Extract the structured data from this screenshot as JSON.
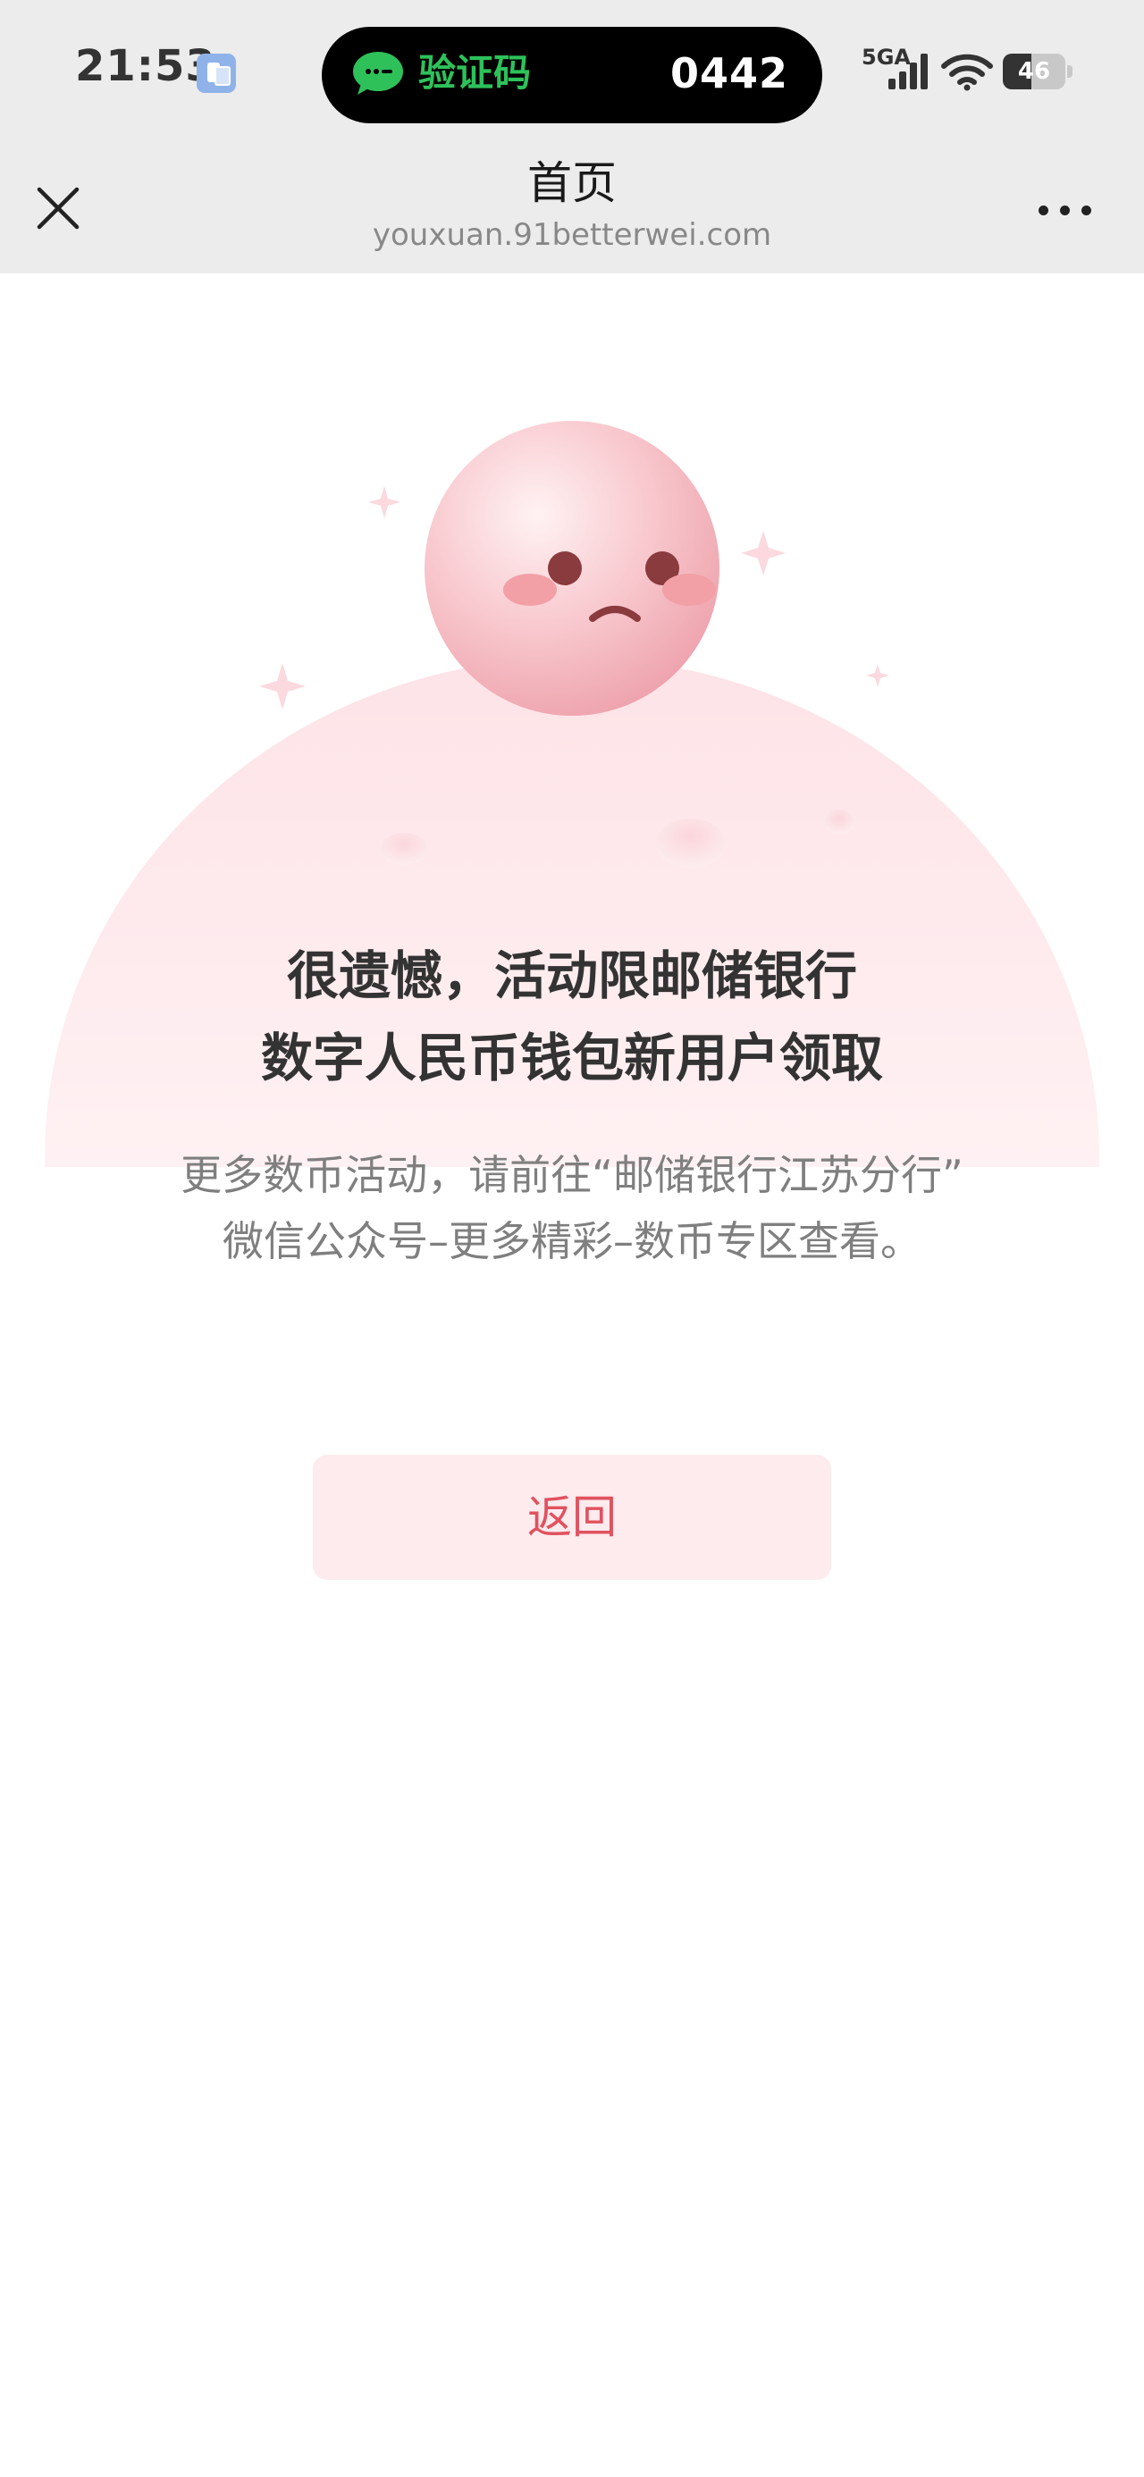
{
  "status_bar": {
    "time": "21:53",
    "notification": {
      "label": "验证码",
      "code": "0442"
    },
    "network": "5GA",
    "battery": {
      "level": 46,
      "text": "46"
    }
  },
  "nav": {
    "title": "首页",
    "url": "youxuan.91betterwei.com"
  },
  "main": {
    "headline_lines": [
      "很遗憾，活动限邮储银行",
      "数字人民币钱包新用户领取"
    ],
    "description_lines": [
      "更多数币活动，请前往“邮储银行江苏分行”",
      "微信公众号–更多精彩–数币专区查看。"
    ],
    "back_button_label": "返回"
  },
  "colors": {
    "accent": "#e0525f",
    "button_bg": "#fdebee",
    "island_green": "#2ec15a",
    "bar_bg": "#ececec"
  }
}
